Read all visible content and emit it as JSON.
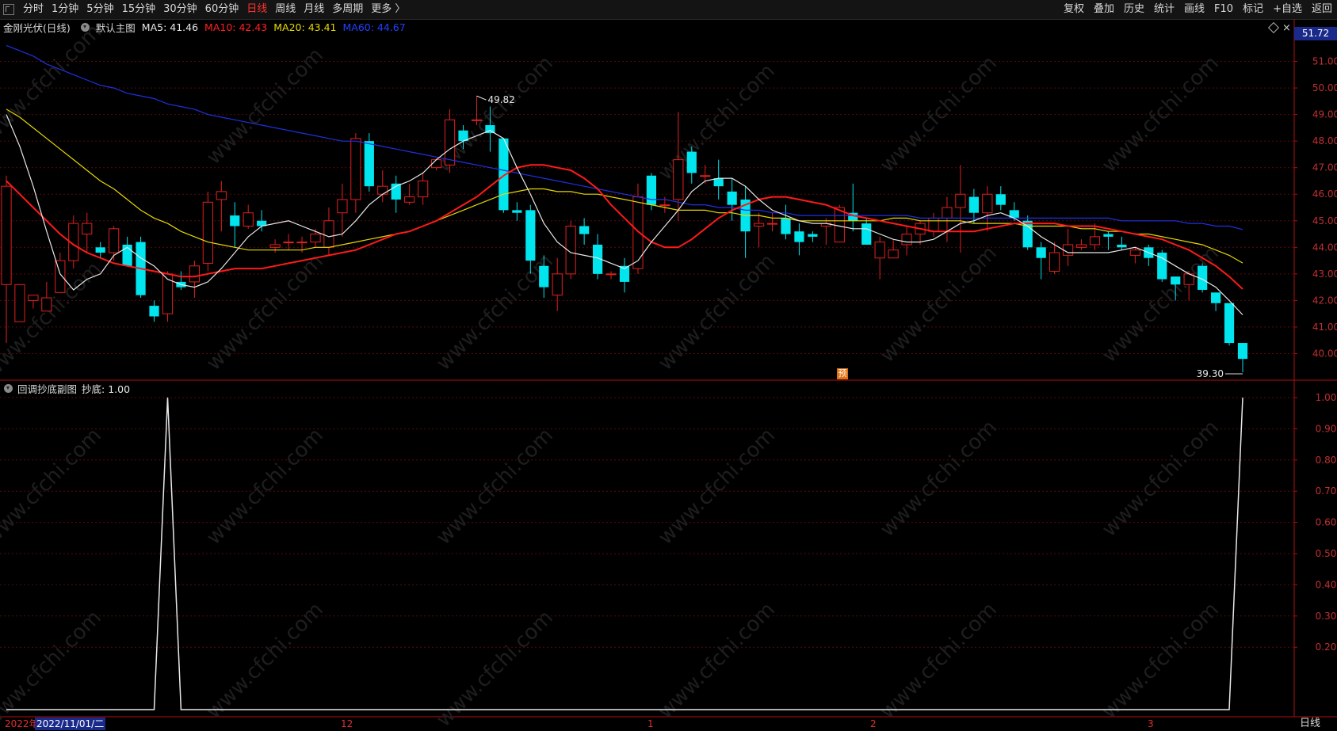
{
  "toolbar": {
    "periods": [
      "分时",
      "1分钟",
      "5分钟",
      "15分钟",
      "30分钟",
      "60分钟",
      "日线",
      "周线",
      "月线",
      "多周期",
      "更多 〉"
    ],
    "active_period": "日线",
    "right_buttons": [
      "复权",
      "叠加",
      "历史",
      "统计",
      "画线",
      "F10",
      "标记",
      "+自选",
      "返回"
    ]
  },
  "legend": {
    "stock": "金刚光伏(日线)",
    "template": "默认主图",
    "ma5": "MA5: 41.46",
    "ma10": "MA10: 42.43",
    "ma20": "MA20: 43.41",
    "ma60": "MA60: 44.67"
  },
  "colors": {
    "ma5": "#e8e8e8",
    "ma10": "#ff1a1a",
    "ma20": "#e6d800",
    "ma60": "#2030e0",
    "up": "#e02020",
    "down": "#00e5ee",
    "grid": "#5a0a0a",
    "axis": "#b01010",
    "sub": "#e8e8e8"
  },
  "price_axis": {
    "current": "51.72",
    "ticks": [
      "51.00",
      "50.00",
      "49.00",
      "48.00",
      "47.00",
      "46.00",
      "45.00",
      "44.00",
      "43.00",
      "42.00",
      "41.00",
      "40.00"
    ]
  },
  "annotations": {
    "high": "49.82",
    "low": "39.30",
    "forecast": "预"
  },
  "indicator": {
    "title": "回调抄底副图",
    "value": "抄底: 1.00",
    "ticks": [
      "1.00",
      "0.90",
      "0.80",
      "0.70",
      "0.60",
      "0.50",
      "0.40",
      "0.30",
      "0.20"
    ]
  },
  "x_axis": {
    "year": "2022年",
    "cursor_date": "2022/11/01/二",
    "months": [
      "12",
      "1",
      "2",
      "3"
    ]
  },
  "period_label": "日线",
  "watermark": "www.cfchi.com",
  "chart_data": {
    "type": "candlestick",
    "title": "金刚光伏(日线)",
    "ylim": [
      39.0,
      52.0
    ],
    "candles": [
      [
        42.6,
        46.3,
        40.4,
        46.7
      ],
      [
        41.2,
        42.6,
        41.5,
        42.4
      ],
      [
        42.0,
        42.2,
        41.7,
        42.0
      ],
      [
        41.6,
        42.1,
        41.7,
        42.7
      ],
      [
        42.3,
        43.5,
        42.3,
        43.8
      ],
      [
        43.5,
        44.9,
        43.2,
        45.2
      ],
      [
        44.5,
        44.9,
        43.8,
        45.3
      ],
      [
        44.0,
        43.8,
        43.6,
        44.2
      ],
      [
        43.8,
        44.7,
        43.5,
        44.8
      ],
      [
        44.1,
        43.3,
        43.3,
        44.4
      ],
      [
        44.2,
        42.2,
        42.1,
        44.4
      ],
      [
        41.8,
        41.4,
        41.2,
        42.0
      ],
      [
        41.5,
        43.0,
        41.2,
        43.1
      ],
      [
        42.7,
        42.5,
        42.4,
        43.1
      ],
      [
        42.7,
        43.3,
        42.1,
        43.5
      ],
      [
        43.4,
        45.7,
        43.1,
        46.1
      ],
      [
        45.8,
        46.1,
        44.6,
        46.5
      ],
      [
        45.2,
        44.8,
        44.0,
        45.7
      ],
      [
        44.8,
        45.3,
        44.7,
        45.6
      ],
      [
        45.0,
        44.8,
        44.6,
        45.4
      ],
      [
        44.0,
        44.1,
        43.8,
        44.3
      ],
      [
        44.2,
        44.2,
        43.9,
        44.5
      ],
      [
        44.2,
        44.2,
        43.8,
        44.4
      ],
      [
        44.2,
        44.5,
        44.0,
        44.7
      ],
      [
        44.0,
        45.0,
        43.7,
        45.5
      ],
      [
        45.3,
        45.8,
        44.4,
        46.4
      ],
      [
        45.8,
        48.1,
        45.3,
        48.3
      ],
      [
        48.0,
        46.3,
        46.1,
        48.3
      ],
      [
        46.0,
        46.3,
        45.7,
        46.9
      ],
      [
        46.4,
        45.8,
        45.3,
        46.7
      ],
      [
        45.7,
        45.9,
        45.6,
        46.4
      ],
      [
        45.9,
        46.5,
        45.6,
        46.8
      ],
      [
        47.0,
        47.3,
        46.9,
        47.3
      ],
      [
        47.1,
        48.8,
        46.8,
        49.2
      ],
      [
        48.4,
        48.0,
        47.7,
        48.6
      ],
      [
        48.8,
        48.8,
        48.6,
        49.7
      ],
      [
        48.6,
        48.3,
        47.6,
        49.3
      ],
      [
        48.1,
        45.4,
        45.3,
        48.1
      ],
      [
        45.4,
        45.3,
        45.0,
        45.7
      ],
      [
        45.4,
        43.5,
        43.0,
        45.6
      ],
      [
        43.3,
        42.5,
        42.1,
        43.7
      ],
      [
        42.2,
        43.0,
        41.6,
        43.6
      ],
      [
        43.0,
        44.8,
        42.8,
        45.0
      ],
      [
        44.8,
        44.5,
        44.1,
        45.1
      ],
      [
        44.1,
        43.0,
        42.8,
        44.5
      ],
      [
        43.0,
        43.0,
        42.8,
        43.1
      ],
      [
        43.3,
        42.7,
        42.3,
        43.6
      ],
      [
        43.2,
        45.9,
        43.0,
        46.4
      ],
      [
        46.7,
        45.6,
        45.4,
        46.8
      ],
      [
        45.6,
        45.6,
        45.3,
        45.9
      ],
      [
        45.8,
        47.3,
        45.0,
        49.1
      ],
      [
        47.6,
        46.8,
        46.4,
        47.8
      ],
      [
        46.7,
        46.7,
        46.4,
        47.1
      ],
      [
        46.6,
        46.3,
        45.8,
        47.3
      ],
      [
        46.1,
        45.6,
        45.0,
        46.6
      ],
      [
        45.8,
        44.6,
        43.6,
        46.3
      ],
      [
        44.8,
        44.9,
        44.0,
        45.3
      ],
      [
        44.9,
        44.9,
        44.6,
        45.3
      ],
      [
        45.1,
        44.5,
        44.3,
        45.6
      ],
      [
        44.6,
        44.2,
        43.7,
        44.9
      ],
      [
        44.5,
        44.4,
        44.2,
        44.6
      ],
      [
        44.8,
        44.9,
        44.1,
        45.1
      ],
      [
        44.2,
        45.5,
        44.2,
        45.6
      ],
      [
        45.3,
        45.0,
        44.6,
        46.4
      ],
      [
        44.9,
        44.1,
        44.1,
        45.1
      ],
      [
        43.6,
        44.2,
        42.8,
        44.4
      ],
      [
        43.6,
        43.9,
        43.6,
        44.3
      ],
      [
        44.1,
        44.5,
        43.7,
        44.8
      ],
      [
        44.5,
        44.9,
        44.1,
        45.0
      ],
      [
        44.6,
        45.1,
        44.4,
        45.3
      ],
      [
        45.1,
        45.5,
        44.2,
        45.9
      ],
      [
        45.5,
        46.0,
        43.8,
        47.1
      ],
      [
        45.9,
        45.3,
        44.9,
        46.2
      ],
      [
        45.3,
        46.0,
        44.6,
        46.3
      ],
      [
        46.0,
        45.6,
        45.4,
        46.3
      ],
      [
        45.4,
        45.1,
        45.0,
        45.7
      ],
      [
        45.0,
        44.0,
        43.9,
        45.2
      ],
      [
        44.0,
        43.6,
        42.8,
        44.2
      ],
      [
        43.1,
        43.8,
        43.0,
        44.2
      ],
      [
        43.7,
        44.1,
        43.3,
        44.7
      ],
      [
        44.0,
        44.1,
        43.9,
        44.3
      ],
      [
        44.1,
        44.4,
        43.9,
        44.9
      ],
      [
        44.5,
        44.4,
        43.9,
        44.6
      ],
      [
        44.1,
        44.0,
        43.9,
        44.4
      ],
      [
        43.7,
        43.9,
        43.4,
        44.0
      ],
      [
        44.0,
        43.6,
        43.3,
        44.1
      ],
      [
        43.8,
        42.8,
        42.7,
        43.9
      ],
      [
        42.9,
        42.6,
        42.0,
        42.9
      ],
      [
        42.6,
        43.0,
        42.0,
        43.1
      ],
      [
        43.3,
        42.4,
        42.3,
        43.4
      ],
      [
        42.3,
        41.9,
        41.6,
        42.3
      ],
      [
        41.9,
        40.4,
        40.3,
        41.9
      ],
      [
        40.4,
        39.8,
        39.3,
        40.4
      ]
    ],
    "ma5": [
      49.0,
      47.8,
      46.3,
      44.6,
      43.0,
      42.4,
      42.8,
      43.0,
      43.7,
      44.0,
      43.6,
      43.3,
      42.8,
      42.6,
      42.5,
      42.7,
      43.2,
      43.8,
      44.4,
      44.8,
      44.9,
      45.0,
      44.8,
      44.6,
      44.4,
      44.5,
      45.0,
      45.6,
      46.0,
      46.3,
      46.5,
      46.8,
      47.3,
      47.7,
      48.0,
      48.2,
      48.4,
      48.1,
      47.0,
      46.0,
      44.9,
      44.2,
      43.8,
      43.7,
      43.6,
      43.4,
      43.2,
      43.5,
      44.2,
      44.8,
      45.4,
      46.1,
      46.5,
      46.6,
      46.6,
      46.3,
      45.8,
      45.4,
      45.2,
      45.0,
      44.9,
      44.9,
      44.8,
      44.7,
      44.7,
      44.5,
      44.3,
      44.2,
      44.2,
      44.3,
      44.6,
      44.9,
      45.0,
      45.2,
      45.3,
      45.1,
      44.8,
      44.4,
      44.1,
      43.8,
      43.8,
      43.8,
      43.8,
      43.9,
      44.0,
      43.8,
      43.6,
      43.3,
      43.0,
      42.8,
      42.5,
      42.0,
      41.46
    ],
    "ma10": [
      46.5,
      46.0,
      45.5,
      45.0,
      44.5,
      44.1,
      43.8,
      43.6,
      43.4,
      43.3,
      43.2,
      43.1,
      43.0,
      42.9,
      42.9,
      43.0,
      43.1,
      43.2,
      43.2,
      43.2,
      43.3,
      43.4,
      43.5,
      43.6,
      43.7,
      43.8,
      43.9,
      44.1,
      44.3,
      44.5,
      44.6,
      44.8,
      45.0,
      45.3,
      45.6,
      45.9,
      46.3,
      46.7,
      47.0,
      47.1,
      47.1,
      47.0,
      46.9,
      46.6,
      46.2,
      45.6,
      45.1,
      44.6,
      44.2,
      44.0,
      44.0,
      44.3,
      44.7,
      45.1,
      45.4,
      45.6,
      45.8,
      45.9,
      45.9,
      45.8,
      45.7,
      45.6,
      45.4,
      45.2,
      45.1,
      45.0,
      44.9,
      44.8,
      44.7,
      44.6,
      44.6,
      44.6,
      44.6,
      44.7,
      44.8,
      44.9,
      44.9,
      44.9,
      44.9,
      44.8,
      44.8,
      44.8,
      44.7,
      44.6,
      44.5,
      44.4,
      44.3,
      44.1,
      43.9,
      43.6,
      43.3,
      42.9,
      42.43
    ],
    "ma20": [
      49.2,
      48.9,
      48.5,
      48.1,
      47.7,
      47.3,
      46.9,
      46.5,
      46.2,
      45.8,
      45.4,
      45.1,
      44.9,
      44.6,
      44.4,
      44.2,
      44.1,
      44.0,
      43.9,
      43.9,
      43.9,
      43.9,
      43.9,
      44.0,
      44.0,
      44.1,
      44.2,
      44.3,
      44.4,
      44.5,
      44.6,
      44.8,
      45.0,
      45.2,
      45.4,
      45.6,
      45.8,
      46.0,
      46.1,
      46.2,
      46.2,
      46.1,
      46.1,
      46.0,
      46.0,
      45.9,
      45.8,
      45.7,
      45.6,
      45.5,
      45.4,
      45.4,
      45.4,
      45.3,
      45.3,
      45.2,
      45.2,
      45.1,
      45.1,
      45.0,
      45.0,
      45.0,
      45.0,
      45.0,
      45.0,
      45.0,
      45.1,
      45.1,
      45.0,
      45.0,
      45.0,
      45.0,
      44.9,
      44.9,
      44.9,
      44.9,
      44.8,
      44.8,
      44.8,
      44.8,
      44.7,
      44.7,
      44.6,
      44.6,
      44.5,
      44.5,
      44.4,
      44.3,
      44.2,
      44.1,
      43.9,
      43.7,
      43.41
    ],
    "ma60": [
      51.6,
      51.4,
      51.2,
      50.9,
      50.7,
      50.5,
      50.3,
      50.1,
      50.0,
      49.8,
      49.7,
      49.6,
      49.4,
      49.3,
      49.2,
      49.0,
      48.9,
      48.8,
      48.7,
      48.6,
      48.5,
      48.4,
      48.3,
      48.2,
      48.1,
      48.0,
      48.0,
      47.9,
      47.8,
      47.7,
      47.6,
      47.5,
      47.4,
      47.3,
      47.2,
      47.1,
      47.0,
      46.9,
      46.8,
      46.7,
      46.6,
      46.5,
      46.4,
      46.3,
      46.2,
      46.1,
      46.0,
      45.9,
      45.8,
      45.8,
      45.7,
      45.6,
      45.6,
      45.5,
      45.5,
      45.4,
      45.4,
      45.3,
      45.3,
      45.2,
      45.2,
      45.2,
      45.2,
      45.2,
      45.2,
      45.2,
      45.2,
      45.2,
      45.1,
      45.1,
      45.1,
      45.1,
      45.1,
      45.1,
      45.1,
      45.1,
      45.1,
      45.1,
      45.1,
      45.1,
      45.1,
      45.1,
      45.1,
      45.0,
      45.0,
      45.0,
      45.0,
      45.0,
      44.9,
      44.9,
      44.8,
      44.8,
      44.67
    ],
    "indicator_series": [
      0,
      0,
      0,
      0,
      0,
      0,
      0,
      0,
      0,
      0,
      0,
      0,
      1,
      0,
      0,
      0,
      0,
      0,
      0,
      0,
      0,
      0,
      0,
      0,
      0,
      0,
      0,
      0,
      0,
      0,
      0,
      0,
      0,
      0,
      0,
      0,
      0,
      0,
      0,
      0,
      0,
      0,
      0,
      0,
      0,
      0,
      0,
      0,
      0,
      0,
      0,
      0,
      0,
      0,
      0,
      0,
      0,
      0,
      0,
      0,
      0,
      0,
      0,
      0,
      0,
      0,
      0,
      0,
      0,
      0,
      0,
      0,
      0,
      0,
      0,
      0,
      0,
      0,
      0,
      0,
      0,
      0,
      0,
      0,
      0,
      0,
      0,
      0,
      0,
      0,
      0,
      0,
      1
    ],
    "indicator_ylim": [
      0.0,
      1.0
    ]
  }
}
